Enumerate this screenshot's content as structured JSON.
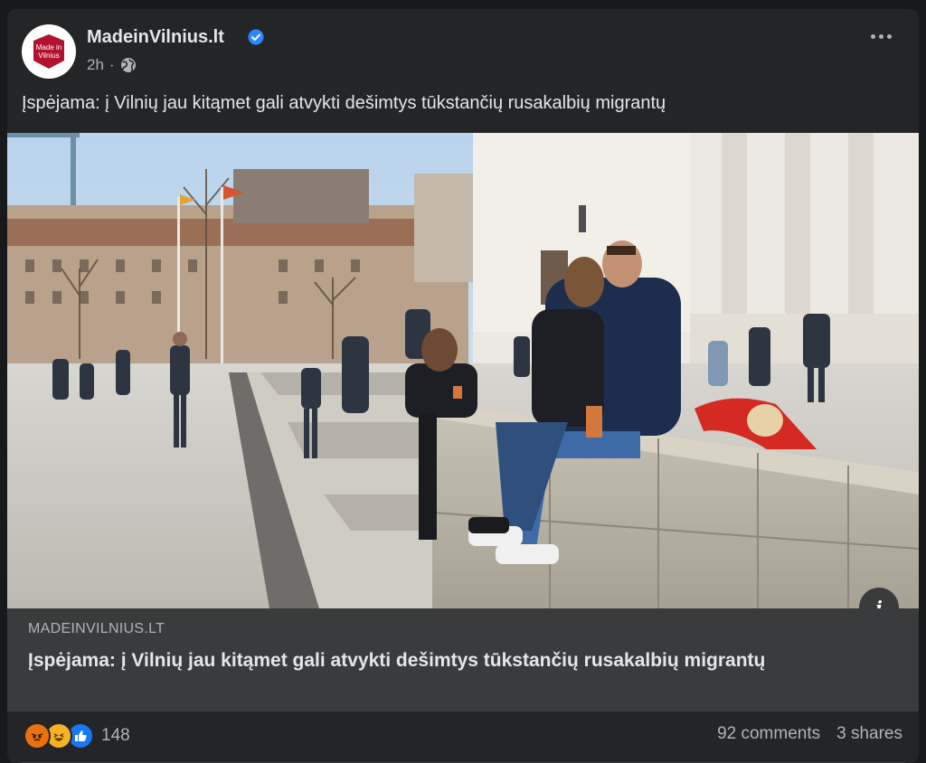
{
  "post": {
    "page_name": "MadeinVilnius.lt",
    "logo_text_line1": "Made in",
    "logo_text_line2": "Vilnius",
    "time": "2h",
    "separator": "·",
    "text": "Įspėjama: į Vilnių jau kitąmet gali atvykti dešimtys tūkstančių rusakalbių migrantų",
    "icons": [
      "verified-icon",
      "globe-icon",
      "more-options-icon",
      "info-icon"
    ]
  },
  "link": {
    "domain": "MADEINVILNIUS.LT",
    "title": "Įspėjama: į Vilnių jau kitąmet gali atvykti dešimtys tūkstančių rusakalbių migrantų",
    "info_glyph": "i"
  },
  "footer": {
    "reactions": [
      "angry",
      "haha",
      "like"
    ],
    "reaction_count": "148",
    "comments": "92 comments",
    "shares": "3 shares"
  },
  "colors": {
    "background": "#18191a",
    "card": "#242526",
    "link_box": "#3a3b3c",
    "verified": "#2d88ff",
    "logo_red": "#b3122e",
    "like_blue": "#1877f2",
    "angry": "#e9710f",
    "haha": "#f7b125"
  }
}
